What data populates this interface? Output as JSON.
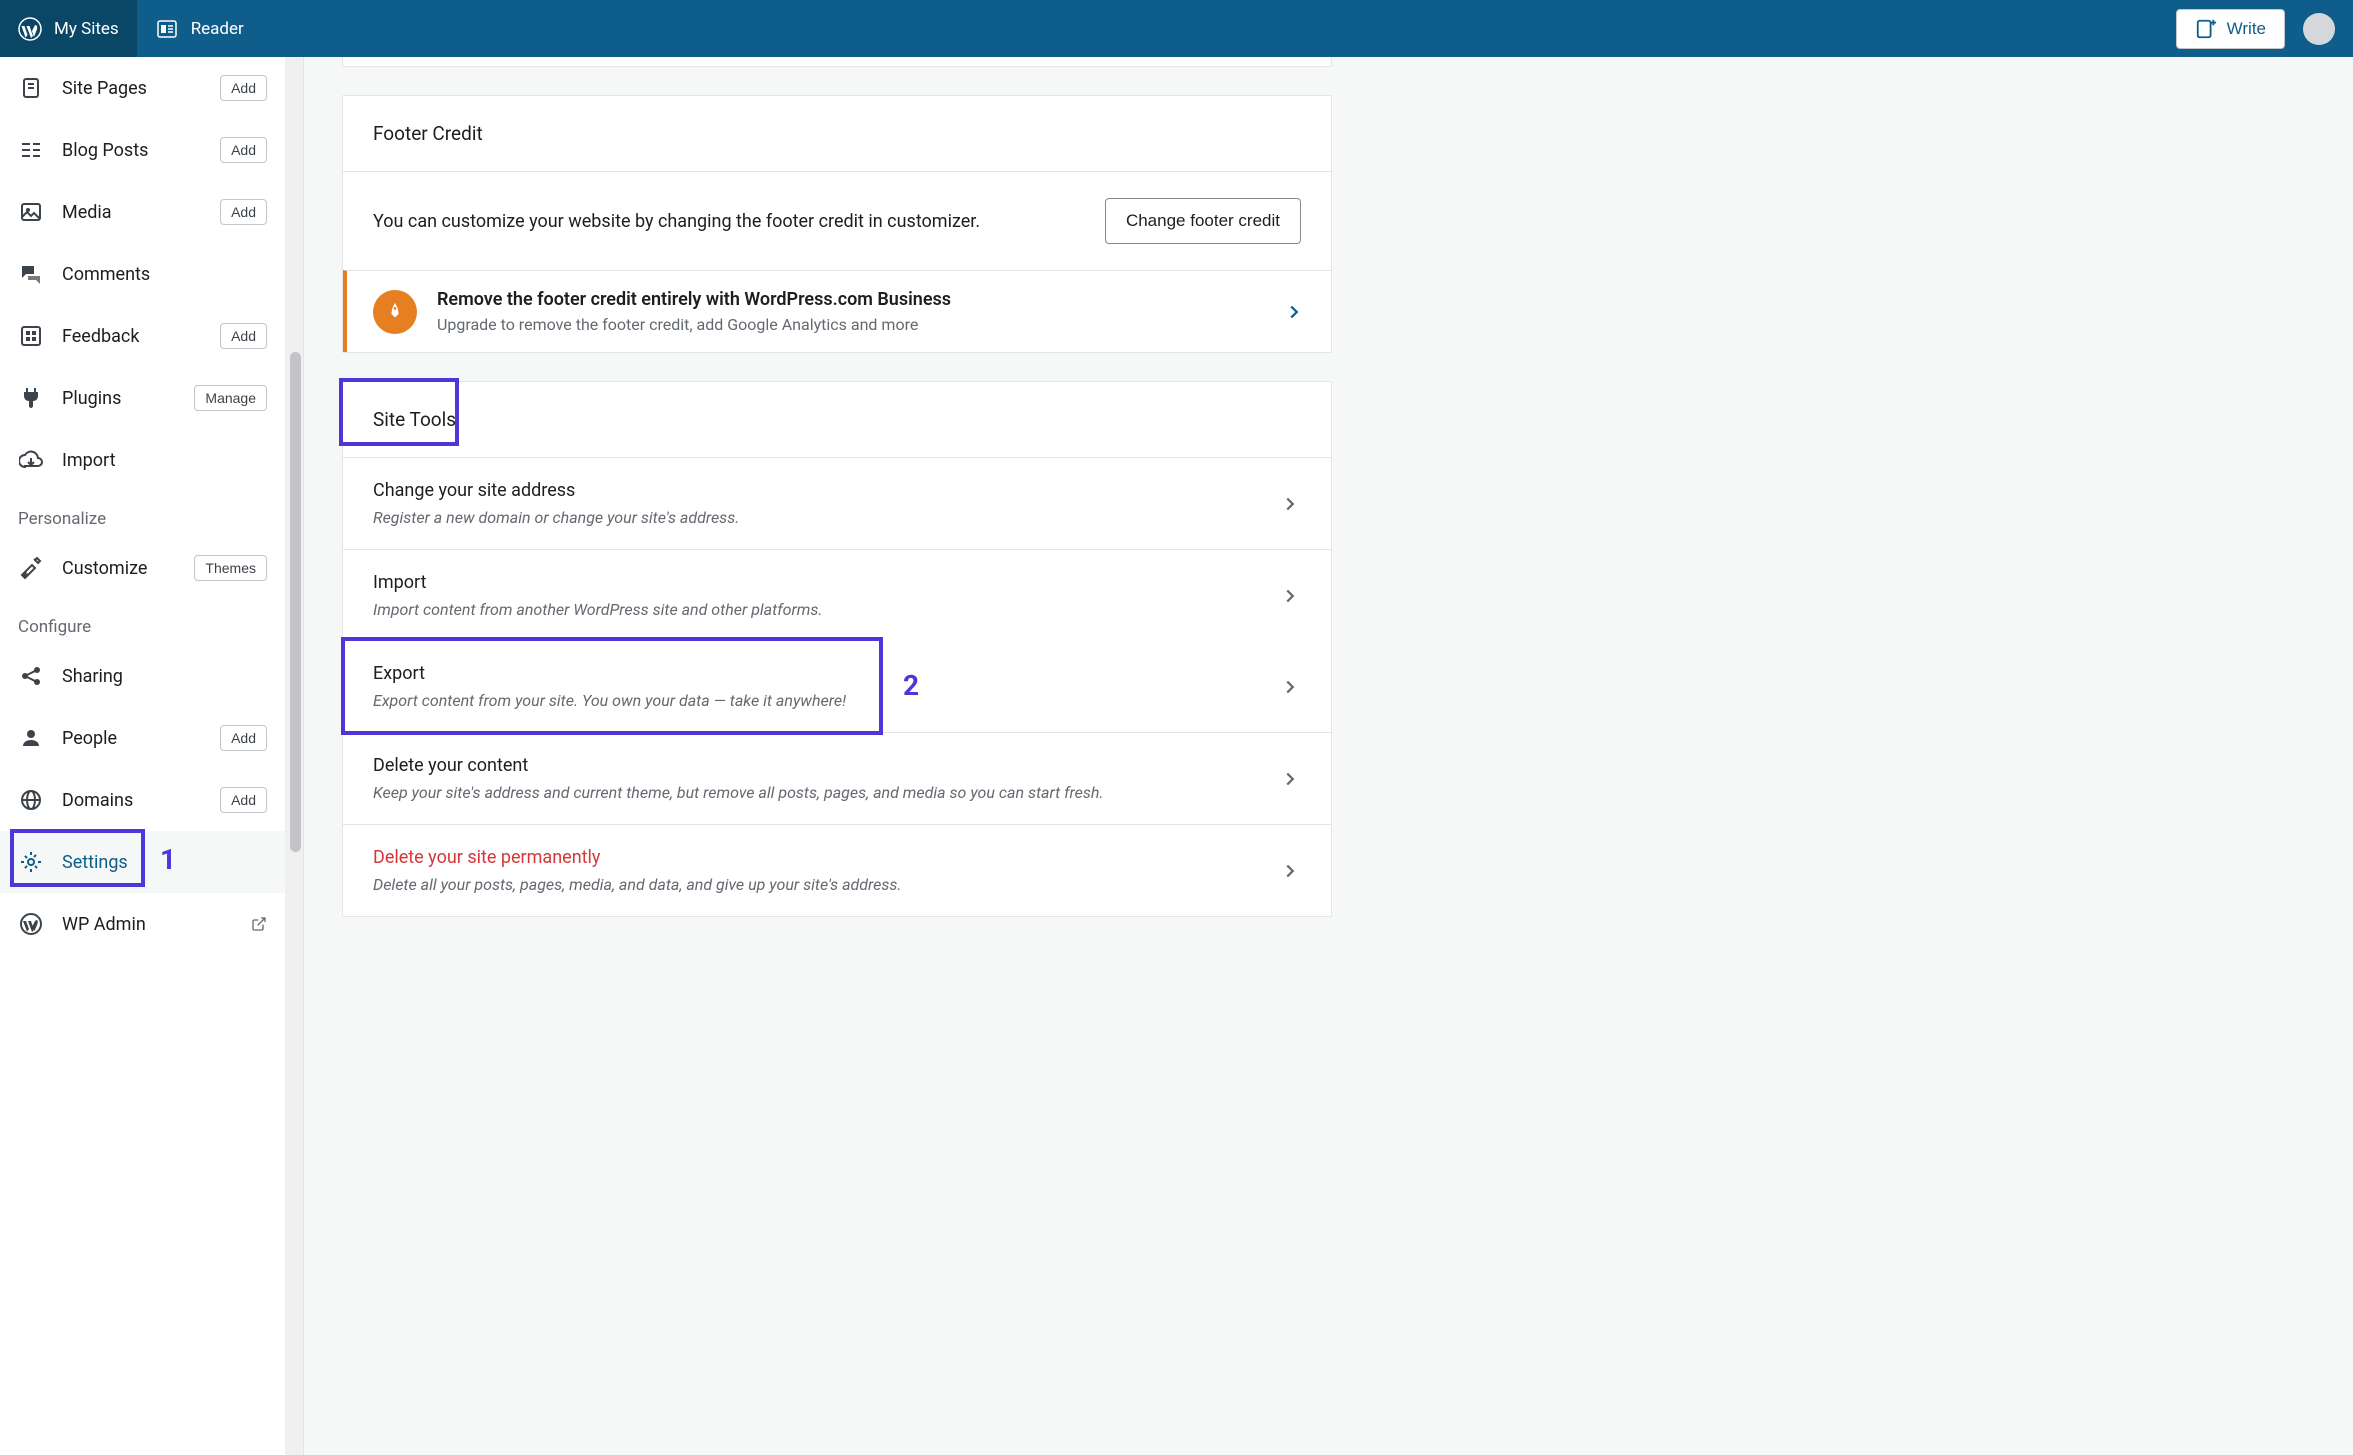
{
  "topbar": {
    "my_sites": "My Sites",
    "reader": "Reader",
    "write": "Write"
  },
  "sidebar": {
    "items": [
      {
        "label": "Site Pages",
        "button": "Add",
        "icon": "page-icon"
      },
      {
        "label": "Blog Posts",
        "button": "Add",
        "icon": "posts-icon"
      },
      {
        "label": "Media",
        "button": "Add",
        "icon": "media-icon"
      },
      {
        "label": "Comments",
        "button": null,
        "icon": "comments-icon"
      },
      {
        "label": "Feedback",
        "button": "Add",
        "icon": "feedback-icon"
      },
      {
        "label": "Plugins",
        "button": "Manage",
        "icon": "plugins-icon"
      },
      {
        "label": "Import",
        "button": null,
        "icon": "import-icon"
      }
    ],
    "personalize_header": "Personalize",
    "personalize": [
      {
        "label": "Customize",
        "button": "Themes",
        "icon": "customize-icon"
      }
    ],
    "configure_header": "Configure",
    "configure": [
      {
        "label": "Sharing",
        "button": null,
        "icon": "sharing-icon"
      },
      {
        "label": "People",
        "button": "Add",
        "icon": "people-icon"
      },
      {
        "label": "Domains",
        "button": "Add",
        "icon": "domains-icon"
      },
      {
        "label": "Settings",
        "button": null,
        "icon": "settings-icon"
      },
      {
        "label": "WP Admin",
        "button": null,
        "icon": "wpadmin-icon",
        "external": true
      }
    ]
  },
  "footer_credit": {
    "header": "Footer Credit",
    "desc": "You can customize your website by changing the footer credit in customizer.",
    "button": "Change footer credit"
  },
  "promo": {
    "title": "Remove the footer credit entirely with WordPress.com Business",
    "sub": "Upgrade to remove the footer credit, add Google Analytics and more"
  },
  "site_tools": {
    "header": "Site Tools",
    "tools": [
      {
        "title": "Change your site address",
        "sub": "Register a new domain or change your site's address.",
        "danger": false
      },
      {
        "title": "Import",
        "sub": "Import content from another WordPress site and other platforms.",
        "danger": false
      },
      {
        "title": "Export",
        "sub": "Export content from your site. You own your data — take it anywhere!",
        "danger": false
      },
      {
        "title": "Delete your content",
        "sub": "Keep your site's address and current theme, but remove all posts, pages, and media so you can start fresh.",
        "danger": false
      },
      {
        "title": "Delete your site permanently",
        "sub": "Delete all your posts, pages, media, and data, and give up your site's address.",
        "danger": true
      }
    ]
  },
  "annotations": {
    "one": "1",
    "two": "2"
  }
}
